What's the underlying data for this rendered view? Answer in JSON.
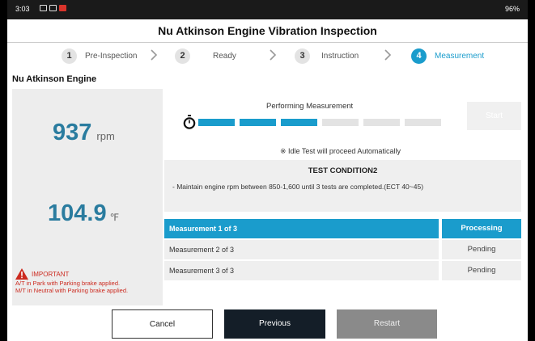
{
  "status_bar": {
    "time": "3:03",
    "battery": "96%"
  },
  "window": {
    "title": "Nu Atkinson Engine Vibration Inspection"
  },
  "steps": [
    {
      "num": "1",
      "label": "Pre-Inspection",
      "active": false
    },
    {
      "num": "2",
      "label": "Ready",
      "active": false
    },
    {
      "num": "3",
      "label": "Instruction",
      "active": false
    },
    {
      "num": "4",
      "label": "Measurement",
      "active": true
    }
  ],
  "section_title": "Nu Atkinson Engine",
  "readings": {
    "rpm_value": "937",
    "rpm_unit": "rpm",
    "temp_value": "104.9",
    "temp_unit": "℉"
  },
  "warning": {
    "title": "IMPORTANT",
    "lines": [
      "A/T in Park with Parking brake applied.",
      "M/T in Neutral with Parking brake applied."
    ]
  },
  "measurement": {
    "title": "Performing Measurement",
    "segments_total": 6,
    "segments_done": 3,
    "start_label": "Start",
    "idle_note": "※ Idle Test will proceed Automatically"
  },
  "test_condition": {
    "title": "TEST CONDITION2",
    "text": "- Maintain engine rpm between 850-1,600 until 3 tests are completed.(ECT 40~45)"
  },
  "table": {
    "rows": [
      {
        "name": "Measurement 1 of 3",
        "status": "Processing",
        "active": true
      },
      {
        "name": "Measurement 2 of 3",
        "status": "Pending",
        "active": false
      },
      {
        "name": "Measurement 3 of 3",
        "status": "Pending",
        "active": false
      }
    ]
  },
  "buttons": {
    "cancel": "Cancel",
    "previous": "Previous",
    "restart": "Restart"
  },
  "colors": {
    "accent": "#1a9ccc",
    "value": "#2a7c9f",
    "warning": "#cc2a1f",
    "dark_button": "#141e28"
  }
}
